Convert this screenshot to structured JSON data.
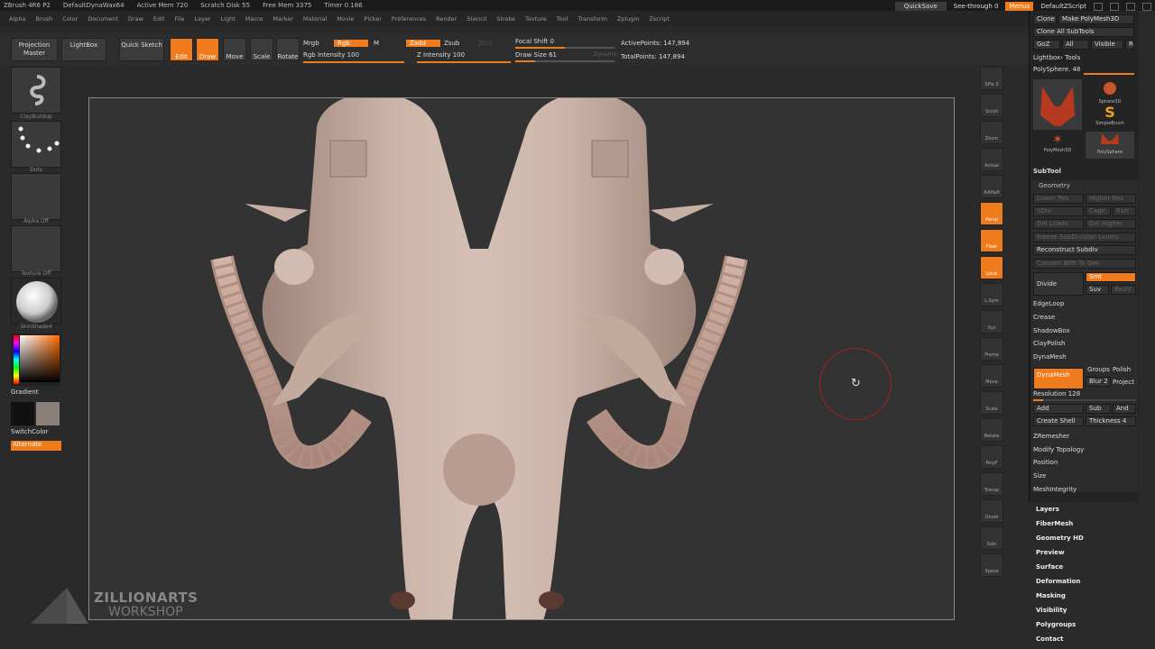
{
  "titlebar": {
    "items": [
      "ZBrush 4R6 P2",
      "DefaultDynaWax64",
      "Active Mem 720",
      "Scratch Disk 55",
      "Free Mem 3375",
      "Timer 0.186"
    ]
  },
  "menubar": {
    "items": [
      "Alpha",
      "Brush",
      "Color",
      "Document",
      "Draw",
      "Edit",
      "File",
      "Layer",
      "Light",
      "Macro",
      "Marker",
      "Material",
      "Movie",
      "Picker",
      "Preferences",
      "Render",
      "Stencil",
      "Stroke",
      "Texture",
      "Tool",
      "Transform",
      "Zplugin",
      "Zscript"
    ]
  },
  "topright": {
    "quicksave": "QuickSave",
    "see_through": "See-through 0",
    "menus": "Menus",
    "script": "DefaultZScript"
  },
  "toolbar": {
    "projection_master": "Projection Master",
    "lightbox": "LightBox",
    "quick_sketch": "Quick Sketch",
    "edit": "Edit",
    "draw": "Draw",
    "move": "Move",
    "scale": "Scale",
    "rotate": "Rotate",
    "mrgb": "Mrgb",
    "rgb": "Rgb",
    "m": "M",
    "rgb_intensity": "Rgb Intensity 100",
    "zadd": "Zadd",
    "zsub": "Zsub",
    "zcut": "Zcut",
    "z_intensity": "Z Intensity 100",
    "focal_shift": "Focal Shift 0",
    "draw_size": "Draw Size 61",
    "dynamic": "Dynamic",
    "active_points": "ActivePoints: 147,894",
    "total_points": "TotalPoints: 147,894"
  },
  "leftshelf": {
    "brush_caption": "ClayBuildup",
    "stroke_caption": "Dots",
    "alpha_caption": "Alpha Off",
    "texture_caption": "Texture Off",
    "material_caption": "SkinShade4",
    "gradient": "Gradient",
    "switch_color": "SwitchColor",
    "alternate": "Alternate"
  },
  "rightshelf": {
    "items": [
      "SPix 3",
      "Scroll",
      "Zoom",
      "Actual",
      "AAHalf",
      "Persp",
      "Floor",
      "Local",
      "L.Sym",
      "Xyz",
      "Frame",
      "Move",
      "Scale",
      "Rotate",
      "PolyF",
      "Transp",
      "Ghost",
      "Solo",
      "Xpose"
    ]
  },
  "panel": {
    "clone": "Clone",
    "make_polymesh": "Make PolyMesh3D",
    "clone_all": "Clone All SubTools",
    "goz": "GoZ",
    "all": "All",
    "visible": "Visible",
    "r": "R",
    "lightbox_tools": "Lightbox› Tools",
    "polysphere": "PolySphere. 48",
    "tools": [
      "PolySphere",
      "Sphere3D",
      "SimpleBrush",
      "PolyMesh3D",
      "PolySphere"
    ],
    "subtool": "SubTool",
    "geometry": "Geometry",
    "lower_res": "Lower Res",
    "higher_res": "Higher Res",
    "sdiv": "SDiv",
    "cage": "Cage",
    "rstr": "Rstr",
    "del_lower": "Del Lower",
    "del_higher": "Del Higher",
    "freeze": "Freeze SubDivision Levels",
    "reconstruct": "Reconstruct Subdiv",
    "convert_bpr": "Convert BPR To Geo",
    "divide": "Divide",
    "smt": "Smt",
    "suv": "Suv",
    "reuv": "ReUV",
    "edgeloop": "EdgeLoop",
    "crease": "Crease",
    "shadowbox": "ShadowBox",
    "claypolish": "ClayPolish",
    "dynamesh_header": "DynaMesh",
    "dynamesh_btn": "DynaMesh",
    "groups": "Groups",
    "polish": "Polish",
    "blur": "Blur 2",
    "project": "Project",
    "resolution": "Resolution 128",
    "add": "Add",
    "sub": "Sub",
    "and": "And",
    "create_shell": "Create Shell",
    "thickness": "Thickness 4",
    "zremesher": "ZRemesher",
    "modify_topology": "Modify Topology",
    "position": "Position",
    "size": "Size",
    "meshintegrity": "MeshIntegrity"
  },
  "bottompanel": {
    "items": [
      "Layers",
      "FiberMesh",
      "Geometry HD",
      "Preview",
      "Surface",
      "Deformation",
      "Masking",
      "Visibility",
      "Polygroups",
      "Contact"
    ]
  },
  "logo": {
    "line1": "ZILLIONARTS",
    "line2": "WORKSHOP"
  },
  "colors": {
    "accent": "#f07b1d",
    "model": "#c8afa3",
    "background": "#2a2a2a"
  }
}
